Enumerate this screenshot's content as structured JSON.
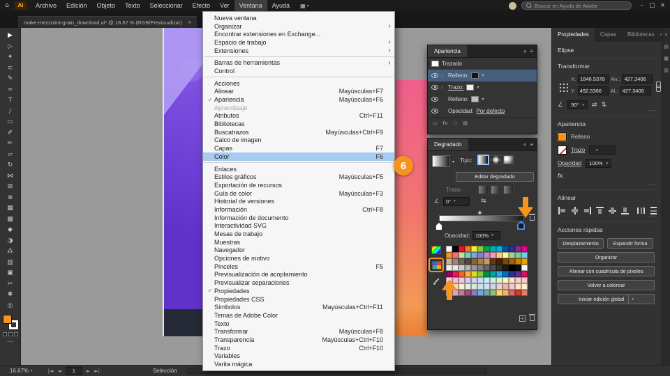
{
  "titlebar": {
    "home_icon": "⌂",
    "logo": "Ai",
    "menus": [
      "Archivo",
      "Edición",
      "Objeto",
      "Texto",
      "Seleccionar",
      "Efecto",
      "Ver",
      "Ventana",
      "Ayuda"
    ],
    "active_menu": "Ventana",
    "arrange_icon": "▦",
    "search_placeholder": "Buscar en Ayuda de Adobe",
    "window_buttons": [
      "–",
      "□",
      "×"
    ]
  },
  "document_tab": {
    "title": "make-mezzotint-grain_download.ai* @ 16.67 % (RGB/Previsualizar)",
    "close": "×"
  },
  "window_menu": {
    "items": [
      {
        "label": "Nueva ventana"
      },
      {
        "label": "Organizar",
        "submenu": true
      },
      {
        "label": "Encontrar extensiones en Exchange..."
      },
      {
        "label": "Espacio de trabajo",
        "submenu": true
      },
      {
        "label": "Extensiones",
        "submenu": true
      },
      {
        "sep": true
      },
      {
        "label": "Barras de herramientas",
        "submenu": true
      },
      {
        "label": "Control"
      },
      {
        "sep": true
      },
      {
        "label": "Acciones"
      },
      {
        "label": "Alinear",
        "shortcut": "Mayúsculas+F7"
      },
      {
        "label": "Apariencia",
        "shortcut": "Mayúsculas+F6",
        "checked": true
      },
      {
        "label": "Aprendizaje",
        "disabled": true
      },
      {
        "label": "Atributos",
        "shortcut": "Ctrl+F11"
      },
      {
        "label": "Bibliotecas"
      },
      {
        "label": "Buscatrazos",
        "shortcut": "Mayúsculas+Ctrl+F9"
      },
      {
        "label": "Calco de imagen"
      },
      {
        "label": "Capas",
        "shortcut": "F7"
      },
      {
        "label": "Color",
        "shortcut": "F6",
        "highlighted": true
      },
      {
        "sep": true
      },
      {
        "label": "Enlaces"
      },
      {
        "label": "Estilos gráficos",
        "shortcut": "Mayúsculas+F5"
      },
      {
        "label": "Exportación de recursos"
      },
      {
        "label": "Guía de color",
        "shortcut": "Mayúsculas+F3"
      },
      {
        "label": "Historial de versiones"
      },
      {
        "label": "Información",
        "shortcut": "Ctrl+F8"
      },
      {
        "label": "Información de documento"
      },
      {
        "label": "Interactividad SVG"
      },
      {
        "label": "Mesas de trabajo"
      },
      {
        "label": "Muestras"
      },
      {
        "label": "Navegador"
      },
      {
        "label": "Opciones de motivo"
      },
      {
        "label": "Pinceles",
        "shortcut": "F5"
      },
      {
        "label": "Previsualización de acoplamiento"
      },
      {
        "label": "Previsualizar separaciones"
      },
      {
        "label": "Propiedades",
        "checked": true
      },
      {
        "label": "Propiedades CSS"
      },
      {
        "label": "Símbolos",
        "shortcut": "Mayúsculas+Ctrl+F11"
      },
      {
        "label": "Temas de Adobe Color"
      },
      {
        "label": "Texto"
      },
      {
        "label": "Transformar",
        "shortcut": "Mayúsculas+F8"
      },
      {
        "label": "Transparencia",
        "shortcut": "Mayúsculas+Ctrl+F10"
      },
      {
        "label": "Trazo",
        "shortcut": "Ctrl+F10"
      },
      {
        "label": "Variables"
      },
      {
        "label": "Varita mágica"
      }
    ]
  },
  "tools": [
    {
      "name": "selection",
      "glyph": "▶"
    },
    {
      "name": "direct-selection",
      "glyph": "▷"
    },
    {
      "name": "magic-wand",
      "glyph": "✦"
    },
    {
      "name": "lasso",
      "glyph": "⊂"
    },
    {
      "name": "pen",
      "glyph": "✎"
    },
    {
      "name": "curvature",
      "glyph": "≈"
    },
    {
      "name": "type",
      "glyph": "T"
    },
    {
      "name": "line",
      "glyph": "∕"
    },
    {
      "name": "rectangle",
      "glyph": "▭"
    },
    {
      "name": "paintbrush",
      "glyph": "✐"
    },
    {
      "name": "shaper",
      "glyph": "✏"
    },
    {
      "name": "eraser",
      "glyph": "▱"
    },
    {
      "name": "rotate",
      "glyph": "↻"
    },
    {
      "name": "width",
      "glyph": "⋈"
    },
    {
      "name": "free-transform",
      "glyph": "⊞"
    },
    {
      "name": "shape-builder",
      "glyph": "⊕"
    },
    {
      "name": "mesh",
      "glyph": "▦"
    },
    {
      "name": "gradient",
      "glyph": "▩"
    },
    {
      "name": "eyedropper",
      "glyph": "◆"
    },
    {
      "name": "blend",
      "glyph": "◑"
    },
    {
      "name": "symbol-sprayer",
      "glyph": "⁂"
    },
    {
      "name": "column-graph",
      "glyph": "▥"
    },
    {
      "name": "artboard",
      "glyph": "▣"
    },
    {
      "name": "slice",
      "glyph": "✂"
    },
    {
      "name": "hand",
      "glyph": "✱"
    },
    {
      "name": "zoom",
      "glyph": "◎"
    }
  ],
  "toolbar_colors": {
    "fill": "#f7941e"
  },
  "appearance_panel": {
    "title": "Apariencia",
    "collapse_icon": "«",
    "menu_icon": "≡",
    "rows": [
      {
        "label": "Trazado"
      },
      {
        "label": "Relleno:",
        "swatch": "#15151f",
        "selected": true
      },
      {
        "label": "Trazo:",
        "swatch": "#f0f0f0",
        "link": true
      },
      {
        "label": "Relleno:",
        "swatch": "#bfbfbf"
      },
      {
        "label": "Opacidad:",
        "value": "Por defecto"
      }
    ],
    "footer_icons": [
      {
        "name": "add-new-stroke",
        "glyph": "▭"
      },
      {
        "name": "add-effect",
        "glyph": "fx"
      },
      {
        "name": "clear-appearance",
        "glyph": "◌"
      },
      {
        "name": "duplicate-item",
        "glyph": "▤"
      }
    ]
  },
  "gradient_panel": {
    "title": "Degradado",
    "collapse_icon": "«",
    "menu_icon": "≡",
    "type_label": "Tipo:",
    "edit_button": "Editar degradado",
    "stroke_label": "Trazo:",
    "angle_glyph": "∠",
    "angle_value": "0°",
    "reverse_icon": "⇆",
    "opacity_label": "Opacidad:",
    "opacity_value": "100%",
    "stops": {
      "start": "#ffffff",
      "end": "#1a1a1a"
    },
    "swatch_rows": [
      [
        "#ffffff",
        "#000000",
        "#e8112d",
        "#f47b20",
        "#f9ed32",
        "#8dc63f",
        "#00a651",
        "#00b2a9",
        "#00aeef",
        "#0054a6",
        "#2e3192",
        "#92278f",
        "#ec008c"
      ],
      [
        "#f7941e",
        "#f26d7d",
        "#c4df9b",
        "#7accc8",
        "#7da7d9",
        "#8781bd",
        "#bd8cbf",
        "#f49ac1",
        "#fdc689",
        "#fff799",
        "#a3d39c",
        "#82ca9c",
        "#6ccff6"
      ],
      [
        "#c7b299",
        "#998675",
        "#736357",
        "#534741",
        "#8c6239",
        "#a67c52",
        "#c69c6d",
        "#603913",
        "#42210b",
        "#7d4900",
        "#a36209",
        "#c98500",
        "#e6a400"
      ],
      [
        "#f2f2f2",
        "#e6e6e6",
        "#cccccc",
        "#b3b3b3",
        "#999999",
        "#808080",
        "#666666",
        "#4d4d4d",
        "#333333",
        "#1a1a1a",
        "#000000",
        "#0d0d0d",
        "#f9f9f9"
      ],
      [
        "#9e005d",
        "#ed145b",
        "#f26522",
        "#fbb03b",
        "#d9e021",
        "#8cc63f",
        "#009245",
        "#00a99d",
        "#29abe2",
        "#0071bc",
        "#2e3192",
        "#662d91",
        "#d4145a"
      ],
      [
        "#f9d3e0",
        "#f6bcd3",
        "#eec6e6",
        "#ddc9f0",
        "#cfd0f4",
        "#c8def5",
        "#c5ecf7",
        "#cdf1e6",
        "#def3cd",
        "#f8f3c9",
        "#fbe3c5",
        "#f8d1c7",
        "#f3c9cf"
      ],
      [
        "#fde0e0",
        "#fcd5b5",
        "#fbf1c7",
        "#e2efda",
        "#d9ead3",
        "#d0e0e3",
        "#cfe2f3",
        "#d9d2e9",
        "#ead1dc",
        "#e6b8af",
        "#f4cccc",
        "#fce5cd",
        "#fff2cc"
      ],
      [
        "#ead1dc",
        "#d5a6bd",
        "#c27ba0",
        "#a64d79",
        "#8e7cc3",
        "#6fa8dc",
        "#76a5af",
        "#93c47d",
        "#ffd966",
        "#f6b26b",
        "#e06666",
        "#cc4125",
        "#dd7e6b"
      ]
    ]
  },
  "properties": {
    "tabs": [
      {
        "label": "Propiedades",
        "active": true
      },
      {
        "label": "Capas",
        "active": false
      },
      {
        "label": "Bibliotecas",
        "active": false
      }
    ],
    "panel_menu_icon": "≡",
    "object_type": "Elipse",
    "transform": {
      "title": "Transformar",
      "x_label": "X:",
      "x_value": "1846.5378",
      "y_label": "Y:",
      "y_value": "492.5366",
      "w_label": "An.:",
      "w_value": "427.3406",
      "h_label": "Al.:",
      "h_value": "427.3406",
      "angle_glyph": "∠",
      "angle_value": "90°",
      "flip_h": "⇄",
      "flip_v": "⇅",
      "more": "···"
    },
    "appearance": {
      "title": "Apariencia",
      "fill_label": "Relleno",
      "fill_color": "#f7941e",
      "stroke_label": "Trazo",
      "opacity_label": "Opacidad",
      "opacity_value": "100%",
      "fx_label": "fx.",
      "more": "···"
    },
    "align": {
      "title": "Alinear",
      "icons": [
        "al-left",
        "al-hcenter",
        "al-right",
        "al-top",
        "al-vmiddle",
        "al-bottom",
        "dist-h",
        "dist-v"
      ],
      "more": "···"
    },
    "quick_actions": {
      "title": "Acciones rápidas",
      "buttons": [
        {
          "label": "Desplazamiento",
          "half": true
        },
        {
          "label": "Expandir forma",
          "half": true
        },
        {
          "label": "Organizar"
        },
        {
          "label": "Alinear con cuadrícula de píxeles"
        },
        {
          "label": "Volver a colorear"
        },
        {
          "label": "Iniciar edición global",
          "split": true
        }
      ]
    }
  },
  "right_strip_icons": [
    "«",
    "▤",
    "▦",
    "▥"
  ],
  "status_bar": {
    "zoom": "16.67%",
    "first": "|◄",
    "prev": "◄",
    "artboard": "1",
    "next": "►",
    "last": "►|",
    "selection_label": "Selección"
  },
  "annotation": {
    "step": "6"
  }
}
